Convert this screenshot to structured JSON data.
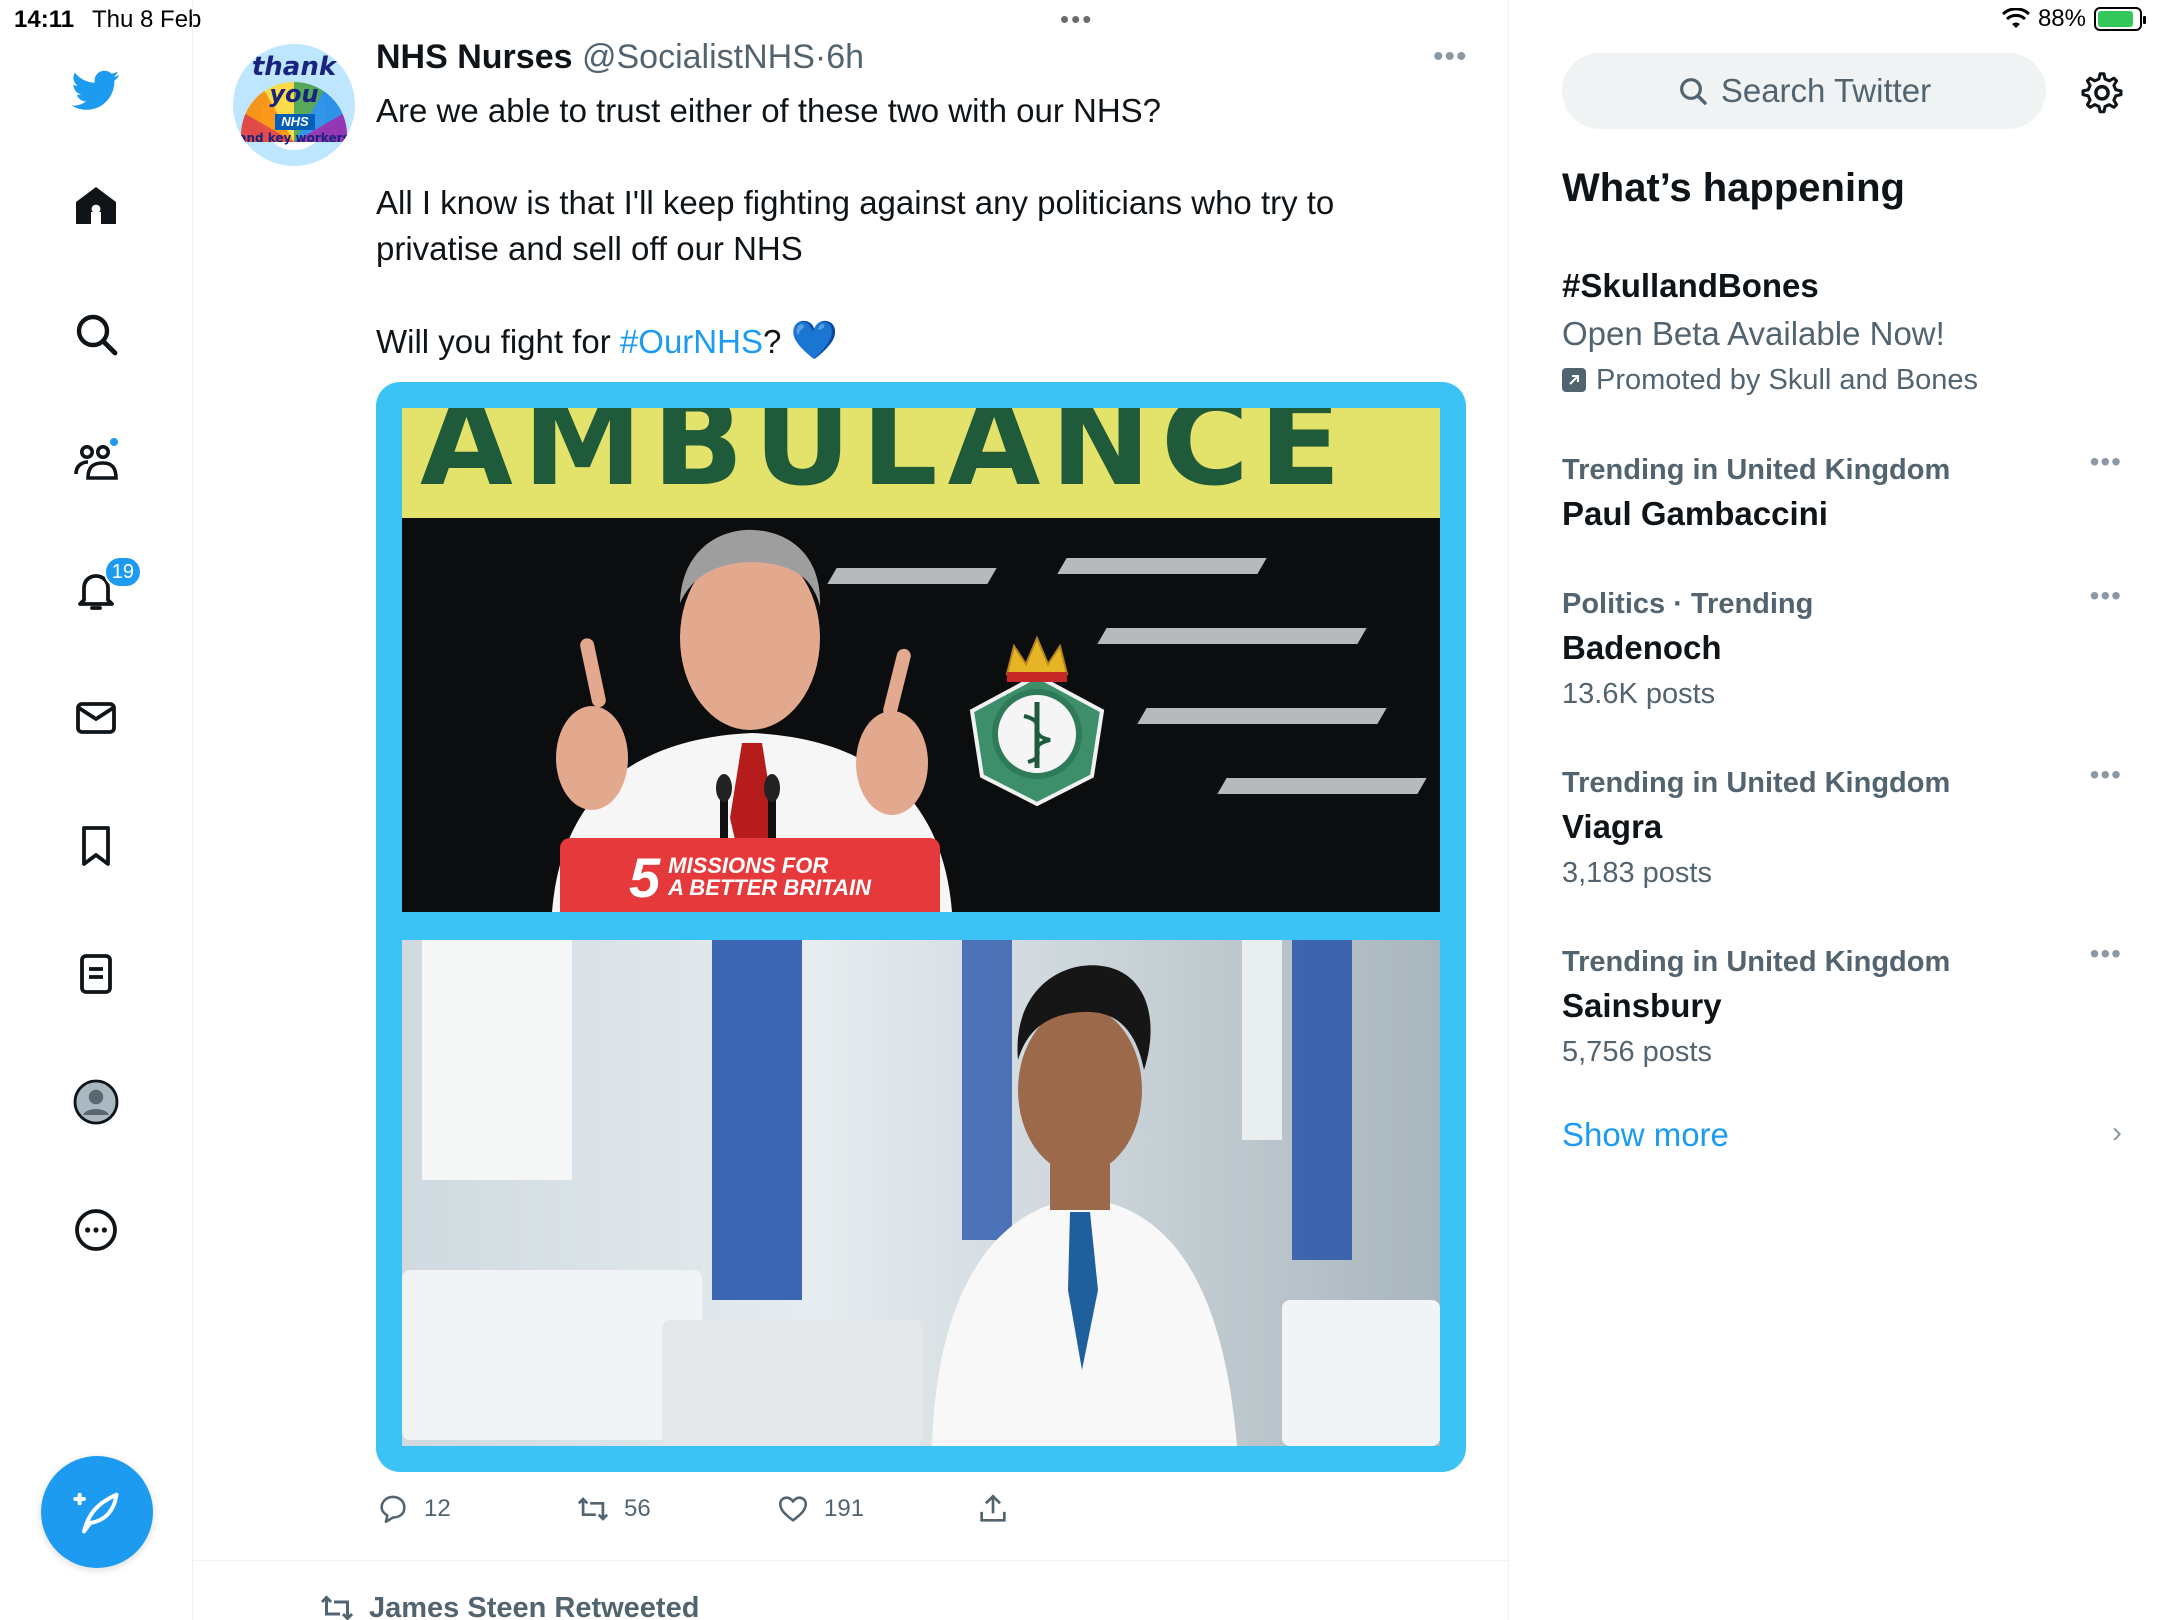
{
  "status_bar": {
    "time": "14:11",
    "date": "Thu 8 Feb",
    "battery": "88%",
    "battery_level": 0.88
  },
  "nav": {
    "items": [
      {
        "name": "twitter-logo",
        "label": ""
      },
      {
        "name": "home",
        "label": ""
      },
      {
        "name": "explore",
        "label": ""
      },
      {
        "name": "communities",
        "label": ""
      },
      {
        "name": "notifications",
        "label": ""
      },
      {
        "name": "messages",
        "label": ""
      },
      {
        "name": "bookmarks",
        "label": ""
      },
      {
        "name": "lists",
        "label": ""
      },
      {
        "name": "profile",
        "label": ""
      },
      {
        "name": "more",
        "label": ""
      }
    ],
    "notifications_count": "19",
    "accent_color": "#1d9bf0"
  },
  "tweet": {
    "author_name": "NHS Nurses",
    "author_handle": "@SocialistNHS",
    "separator": "·",
    "time": "6h",
    "avatar_text": {
      "line1": "thank",
      "line2": "you",
      "nhs": "NHS",
      "line3": "and key workers"
    },
    "text_line1": "Are we able to trust either of these two with our NHS?",
    "text_line2": "All I know is that I'll keep fighting against any politicians who try to privatise and sell off our NHS",
    "text_line3_prefix": "Will you fight for ",
    "hashtag": "#OurNHS",
    "text_line3_suffix": "? ",
    "emoji": "💙",
    "image": {
      "top_banner": "AMBULANCE",
      "podium_number": "5",
      "podium_line1": "MISSIONS FOR",
      "podium_line2": "A BETTER BRITAIN"
    },
    "actions": {
      "replies": "12",
      "retweets": "56",
      "likes": "191"
    }
  },
  "next_item": {
    "retweeted_by": "James Steen Retweeted"
  },
  "sidebar": {
    "search_placeholder": "Search Twitter",
    "section_title": "What’s happening",
    "promoted": {
      "name": "#SkullandBones",
      "description": "Open Beta Available Now!",
      "label": "Promoted by Skull and Bones"
    },
    "trends": [
      {
        "context": "Trending in United Kingdom",
        "name": "Paul Gambaccini",
        "posts": ""
      },
      {
        "context": "Politics · Trending",
        "name": "Badenoch",
        "posts": "13.6K posts"
      },
      {
        "context": "Trending in United Kingdom",
        "name": "Viagra",
        "posts": "3,183 posts"
      },
      {
        "context": "Trending in United Kingdom",
        "name": "Sainsbury",
        "posts": "5,756 posts"
      }
    ],
    "show_more": "Show more"
  }
}
